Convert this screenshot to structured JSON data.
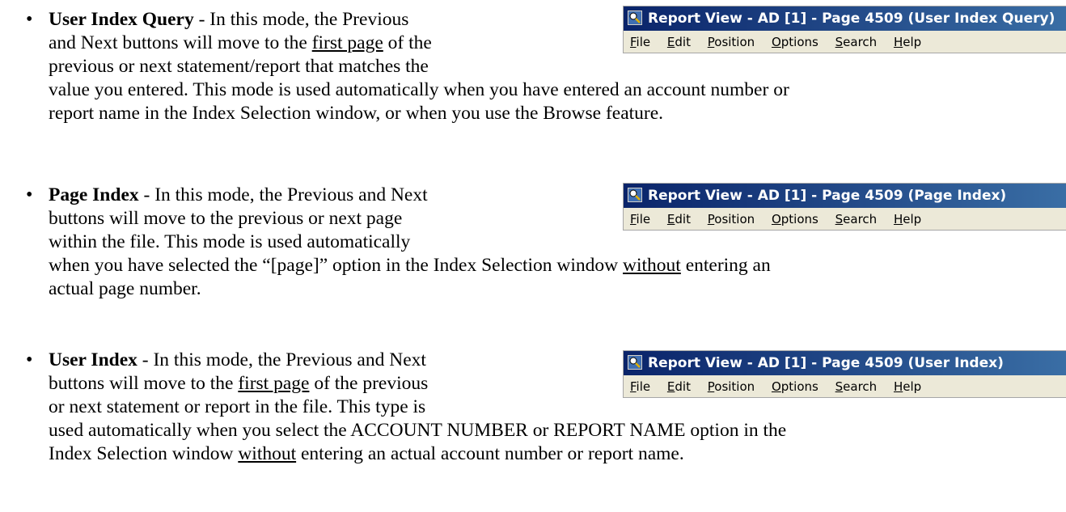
{
  "items": [
    {
      "heading": "User Index Query",
      "lines": [
        " - In this mode, the Previous",
        "and Next buttons will move to the ",
        "first page",
        " of the",
        "previous or next statement/report that matches the"
      ],
      "continuation": [
        "value you entered.  This mode is used automatically when you have entered an account number or",
        "report name in the Index Selection window, or when you use the Browse feature."
      ],
      "window_title": "Report View - AD [1] - Page 4509  (User Index Query)"
    },
    {
      "heading": "Page Index",
      "lines": [
        " - In this mode, the Previous and Next",
        "buttons will move to the previous or next page",
        "within the file.  This mode is used automatically"
      ],
      "continuation": [
        "when you have selected the “[page]” option in the Index Selection window ",
        "without",
        " entering an",
        "actual page number."
      ],
      "window_title": "Report View - AD [1] - Page 4509  (Page Index)"
    },
    {
      "heading": "User Index",
      "lines": [
        " - In this mode, the Previous and Next",
        "buttons will move to the ",
        "first page",
        " of the previous",
        "or next statement or report in the file.  This type is"
      ],
      "continuation": [
        "used automatically when you select the ACCOUNT NUMBER or REPORT NAME option in the",
        "Index Selection window ",
        "without",
        " entering an actual account number or report name."
      ],
      "window_title": "Report View - AD [1] - Page 4509  (User Index)"
    }
  ],
  "menu": [
    {
      "accel": "F",
      "rest": "ile"
    },
    {
      "accel": "E",
      "rest": "dit"
    },
    {
      "accel": "P",
      "rest": "osition"
    },
    {
      "accel": "O",
      "rest": "ptions"
    },
    {
      "accel": "S",
      "rest": "earch"
    },
    {
      "accel": "H",
      "rest": "elp"
    }
  ],
  "bullet_char": "•",
  "icon_name": "report-view-app-icon"
}
